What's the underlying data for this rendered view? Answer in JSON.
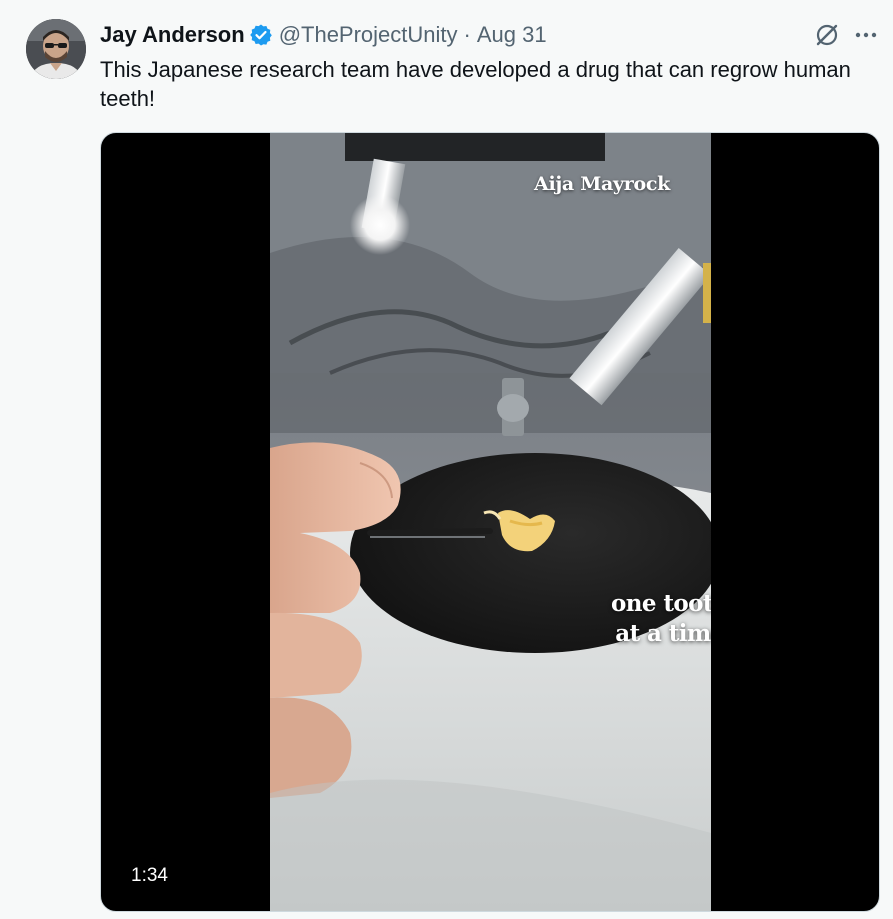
{
  "tweet": {
    "author_name": "Jay Anderson",
    "handle": "@TheProjectUnity",
    "separator": "·",
    "date": "Aug 31",
    "text": "This Japanese research team have developed a drug that can regrow human teeth!",
    "verified_color": "#1d9bf0"
  },
  "media": {
    "watermark": "Aija Mayrock",
    "caption": "one tooth\nat a time",
    "duration": "1:34"
  },
  "icons": {
    "avatar": "avatar",
    "verified": "verified-badge-icon",
    "grok": "grok-icon",
    "more": "more-options-icon"
  }
}
